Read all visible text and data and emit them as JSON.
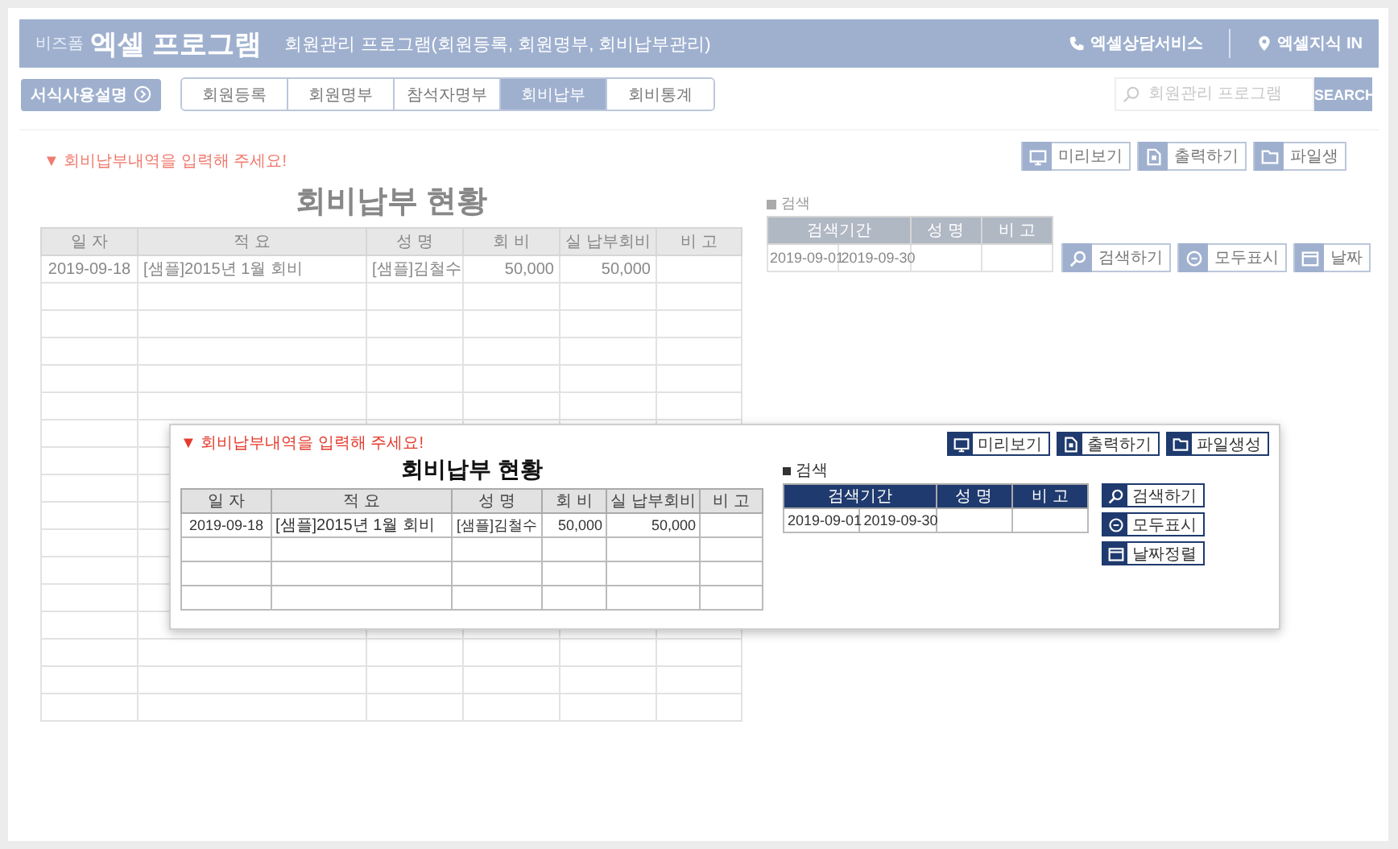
{
  "header": {
    "brand_small": "비즈폼",
    "brand": "엑셀 프로그램",
    "subtitle": "회원관리 프로그램(회원등록, 회원명부, 회비납부관리)",
    "links": [
      {
        "label": "엑셀상담서비스",
        "kind": "phone"
      },
      {
        "label": "엑셀지식 IN",
        "kind": "pin"
      }
    ]
  },
  "guide_button": "서식사용설명",
  "tabs": [
    {
      "label": "회원등록",
      "selected": false
    },
    {
      "label": "회원명부",
      "selected": false
    },
    {
      "label": "참석자명부",
      "selected": false
    },
    {
      "label": "회비납부",
      "selected": true
    },
    {
      "label": "회비통계",
      "selected": false
    }
  ],
  "search": {
    "placeholder": "회원관리 프로그램",
    "button": "SEARCH"
  },
  "notice": "▼ 회비납부내역을 입력해 주세요!",
  "table": {
    "title": "회비납부 현황",
    "columns": [
      "일 자",
      "적 요",
      "성 명",
      "회 비",
      "실 납부회비",
      "비 고"
    ],
    "rows": [
      [
        "2019-09-18",
        "[샘플]2015년 1월 회비",
        "[샘플]김철수",
        "50,000",
        "50,000",
        ""
      ]
    ]
  },
  "tools": [
    {
      "label": "미리보기",
      "kind": "monitor"
    },
    {
      "label": "출력하기",
      "kind": "print"
    },
    {
      "label": "파일생",
      "kind": "folder"
    }
  ],
  "search_panel": {
    "label": "검색",
    "columns": [
      "검색기간",
      "성 명",
      "비 고"
    ],
    "dates": [
      "2019-09-01",
      "2019-09-30"
    ],
    "buttons": [
      {
        "label": "검색하기",
        "kind": "search"
      },
      {
        "label": "모두표시",
        "kind": "all"
      },
      {
        "label": "날짜",
        "kind": "calendar"
      }
    ]
  },
  "inset": {
    "notice": "▼ 회비납부내역을 입력해 주세요!",
    "title": "회비납부 현황",
    "columns": [
      "일 자",
      "적 요",
      "성 명",
      "회 비",
      "실 납부회비",
      "비 고"
    ],
    "rows": [
      [
        "2019-09-18",
        "[샘플]2015년 1월 회비",
        "[샘플]김철수",
        "50,000",
        "50,000",
        ""
      ]
    ],
    "tools": [
      {
        "label": "미리보기",
        "kind": "monitor"
      },
      {
        "label": "출력하기",
        "kind": "print"
      },
      {
        "label": "파일생성",
        "kind": "folder"
      }
    ],
    "search_label": "검색",
    "search_columns": [
      "검색기간",
      "성 명",
      "비 고"
    ],
    "dates": [
      "2019-09-01",
      "2019-09-30"
    ],
    "buttons": [
      {
        "label": "검색하기",
        "kind": "search"
      },
      {
        "label": "모두표시",
        "kind": "all"
      },
      {
        "label": "날짜정렬",
        "kind": "calendar"
      }
    ]
  }
}
